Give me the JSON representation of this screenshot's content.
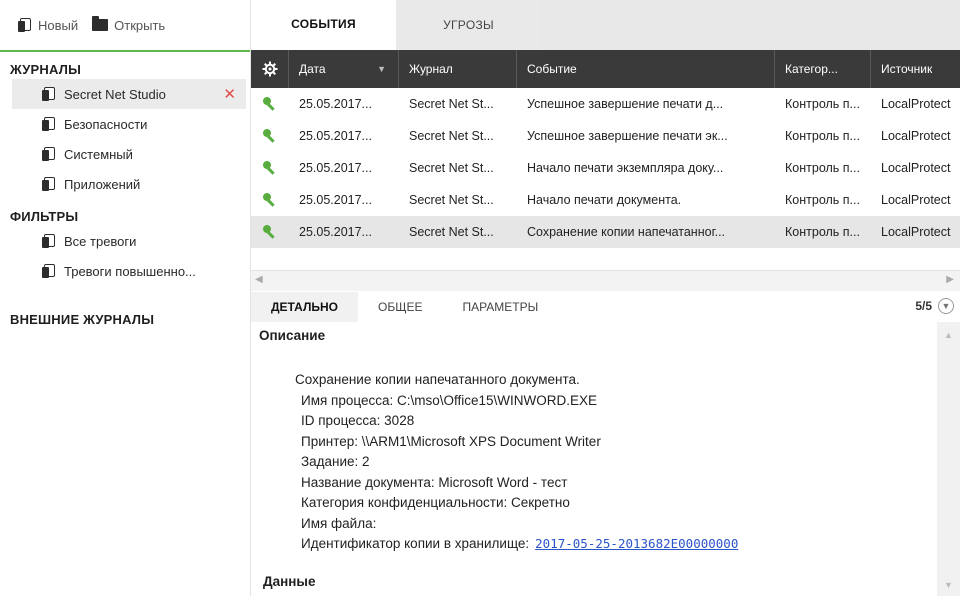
{
  "toolbar": {
    "new_label": "Новый",
    "open_label": "Открыть"
  },
  "sidebar": {
    "journals_title": "ЖУРНАЛЫ",
    "journals": [
      {
        "label": "Secret Net Studio",
        "selected": true
      },
      {
        "label": "Безопасности"
      },
      {
        "label": "Системный"
      },
      {
        "label": "Приложений"
      }
    ],
    "filters_title": "ФИЛЬТРЫ",
    "filters": [
      {
        "label": "Все тревоги"
      },
      {
        "label": "Тревоги повышенно..."
      }
    ],
    "external_title": "ВНЕШНИЕ ЖУРНАЛЫ",
    "close_glyph": "✕"
  },
  "tabs": {
    "events": "СОБЫТИЯ",
    "threats": "УГРОЗЫ"
  },
  "grid": {
    "columns": [
      "Дата",
      "Журнал",
      "Событие",
      "Категор...",
      "Источник"
    ],
    "rows": [
      {
        "date": "25.05.2017...",
        "journal": "Secret Net St...",
        "event": "Успешное завершение печати д...",
        "category": "Контроль п...",
        "source": "LocalProtect"
      },
      {
        "date": "25.05.2017...",
        "journal": "Secret Net St...",
        "event": "Успешное завершение печати эк...",
        "category": "Контроль п...",
        "source": "LocalProtect"
      },
      {
        "date": "25.05.2017...",
        "journal": "Secret Net St...",
        "event": "Начало печати экземпляра доку...",
        "category": "Контроль п...",
        "source": "LocalProtect"
      },
      {
        "date": "25.05.2017...",
        "journal": "Secret Net St...",
        "event": "Начало печати документа.",
        "category": "Контроль п...",
        "source": "LocalProtect"
      },
      {
        "date": "25.05.2017...",
        "journal": "Secret Net St...",
        "event": "Сохранение копии напечатанног...",
        "category": "Контроль п...",
        "source": "LocalProtect",
        "selected": true
      }
    ]
  },
  "detail": {
    "tabs": [
      "ДЕТАЛЬНО",
      "ОБЩЕЕ",
      "ПАРАМЕТРЫ"
    ],
    "counter": "5/5",
    "description_title": "Описание",
    "lines": [
      "Сохранение копии напечатанного документа.",
      "Имя процесса: C:\\mso\\Office15\\WINWORD.EXE",
      "ID процесса: 3028",
      "Принтер: \\\\ARM1\\Microsoft XPS Document Writer",
      "Задание: 2",
      "Название документа: Microsoft Word - тест",
      "Категория конфиденциальности: Секретно",
      "Имя файла:"
    ],
    "copy_id_label": "Идентификатор копии в хранилище:",
    "copy_id_value": "2017-05-25-2013682E00000000",
    "data_title": "Данные"
  },
  "colors": {
    "accent_green": "#5fb84a",
    "header_dark": "#3a3a3a",
    "link_blue": "#2a54c9",
    "close_red": "#e04b4b"
  }
}
